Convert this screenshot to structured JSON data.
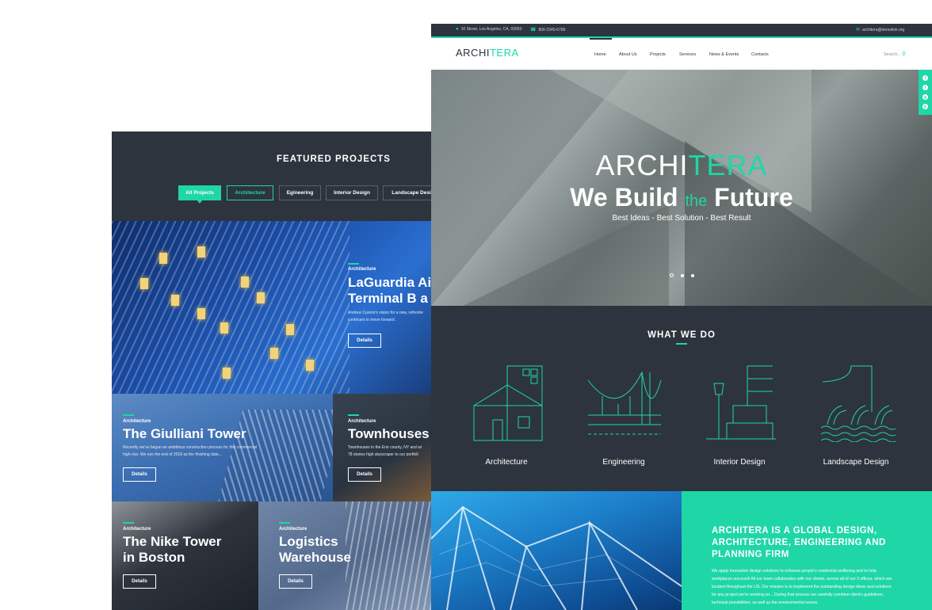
{
  "featured": {
    "title": "FEATURED PROJECTS",
    "filters": [
      "All Projects",
      "Architecture",
      "Egineering",
      "Interior Design",
      "Landscape Design"
    ],
    "details_label": "Details",
    "projects": [
      {
        "category": "Architecture",
        "name_line1": "LaGuardia Ai",
        "name_line2": "Terminal B a",
        "desc_line1": "Andrew Cuomo's vision for a new, refreshe",
        "desc_line2": "continues to move forward."
      },
      {
        "category": "Architecture",
        "name_line1": "The Giulliani Tower",
        "desc_line1": "Recently we've begun an ambitious construction process for this commercial",
        "desc_line2": "high-rise. We eye the end of 2018 as the finishing date..."
      },
      {
        "category": "Architecture",
        "name_line1": "Townhouses",
        "desc_line1": "Townhouses in the Erie county, NY and wi",
        "desc_line2": "78 stories high skyscraper to our portfoli"
      },
      {
        "category": "Architecture",
        "name_line1": "The Nike Tower",
        "name_line2": "in Boston"
      },
      {
        "category": "Architecture",
        "name_line1": "Logistics",
        "name_line2": "Warehouse"
      }
    ]
  },
  "site": {
    "topbar": {
      "address": "10 Street, Los Angeles, CA, 93050",
      "phone": "800-2345-6789",
      "email": "architera@demolink.org"
    },
    "logo": {
      "part1": "ARCHI",
      "part2": "TERA"
    },
    "nav": [
      "Home",
      "About Us",
      "Projects",
      "Services",
      "News & Events",
      "Contacts"
    ],
    "search_placeholder": "Search...",
    "hero": {
      "title_part1": "We Build",
      "title_the": "the",
      "title_part2": "Future",
      "subtitle": "Best Ideas - Best Solution - Best Result"
    },
    "social": [
      "f",
      "t",
      "g",
      "p"
    ],
    "what_we_do": {
      "title": "WHAT WE DO",
      "services": [
        "Architecture",
        "Engineering",
        "Interior Design",
        "Landscape Design"
      ]
    },
    "about": {
      "title": "ARCHITERA IS A GLOBAL DESIGN, ARCHITECTURE, ENGINEERING AND PLANNING FIRM",
      "text": "We apply innovative design solutions to enhance people's residential wellbeing and to help workplaces succeed! All our team collaborates with our clients, across all of our 3 offices, which are located throughout the US. Our mission is to implement the outstanding design ideas and solutions for any project we're working on... During that process we carefully combine client's guidelines, technical possibilities, as well as the environmental issues."
    }
  },
  "colors": {
    "accent": "#1fd6a7",
    "dark": "#2d343d"
  }
}
